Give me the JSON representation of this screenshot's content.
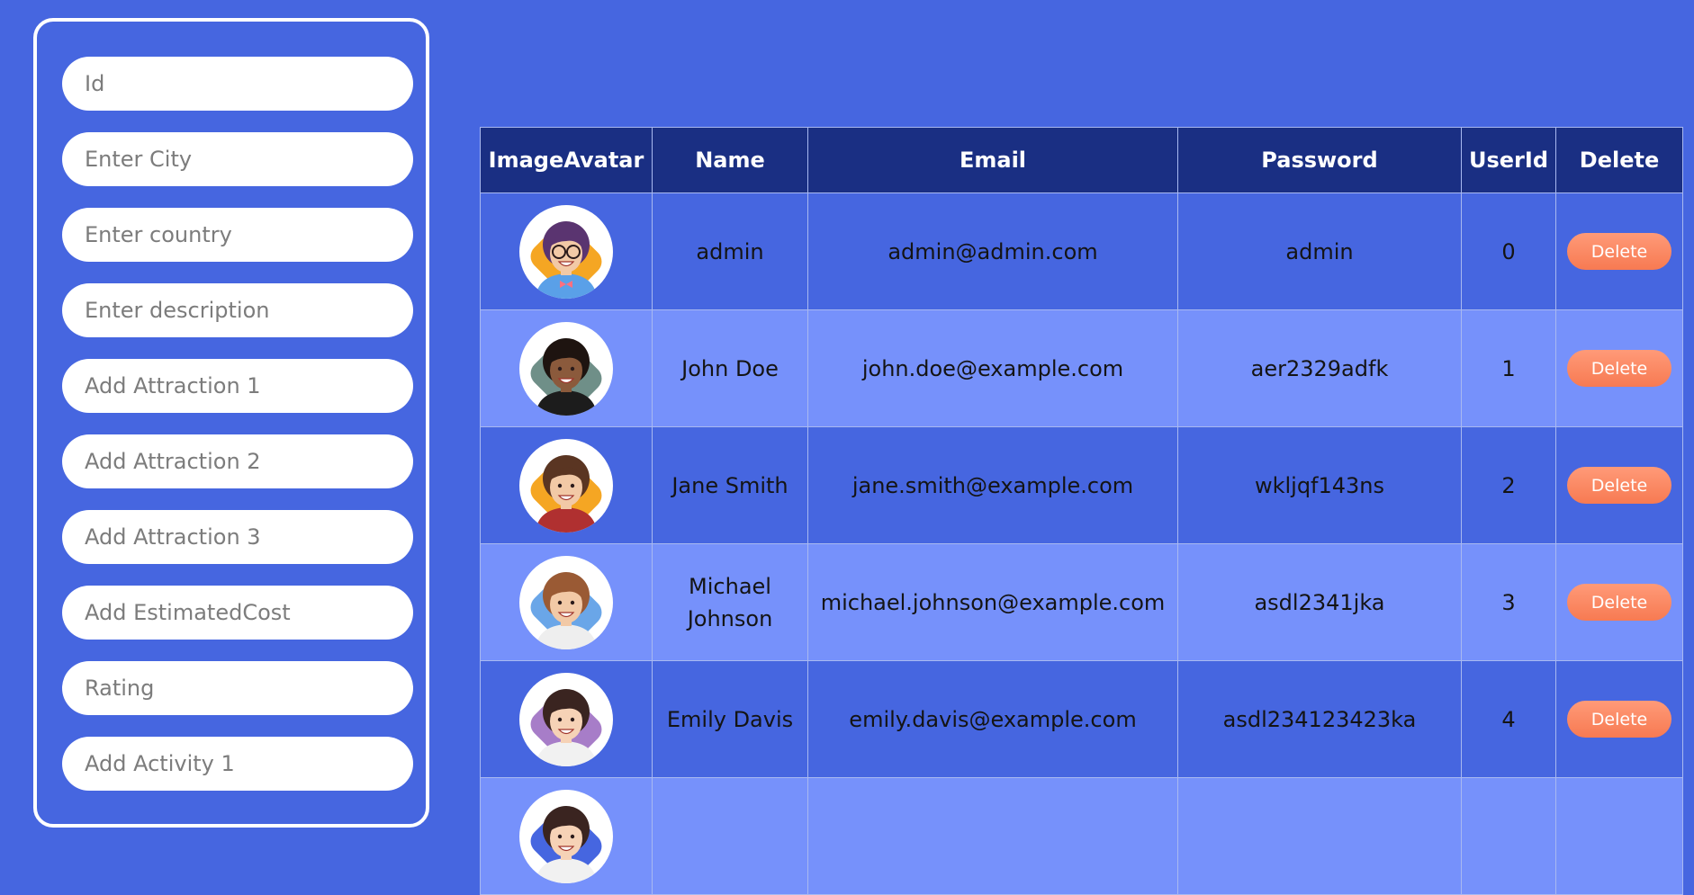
{
  "form": {
    "fields": [
      {
        "name": "id-input",
        "placeholder": "Id"
      },
      {
        "name": "city-input",
        "placeholder": "Enter City"
      },
      {
        "name": "country-input",
        "placeholder": "Enter country"
      },
      {
        "name": "description-input",
        "placeholder": "Enter description"
      },
      {
        "name": "attraction-1-input",
        "placeholder": "Add Attraction 1"
      },
      {
        "name": "attraction-2-input",
        "placeholder": "Add Attraction 2"
      },
      {
        "name": "attraction-3-input",
        "placeholder": "Add Attraction 3"
      },
      {
        "name": "estimated-cost-input",
        "placeholder": "Add EstimatedCost"
      },
      {
        "name": "rating-input",
        "placeholder": "Rating"
      },
      {
        "name": "activity-1-input",
        "placeholder": "Add Activity 1"
      }
    ]
  },
  "table": {
    "headers": {
      "avatar": "ImageAvatar",
      "name": "Name",
      "email": "Email",
      "password": "Password",
      "userid": "UserId",
      "delete": "Delete"
    },
    "rows": [
      {
        "name": "admin",
        "email": "admin@admin.com",
        "password": "admin",
        "userid": "0",
        "delete": "Delete",
        "avatar": {
          "bg": "#f5a623",
          "hair": "#5a3470",
          "skin": "#f2c9a6",
          "shirt": "#5aa0e8",
          "glasses": true,
          "bow": true
        }
      },
      {
        "name": "John Doe",
        "email": "john.doe@example.com",
        "password": "aer2329adfk",
        "userid": "1",
        "delete": "Delete",
        "avatar": {
          "bg": "#6f8f88",
          "hair": "#1e1410",
          "skin": "#8b5a3c",
          "shirt": "#1c1c1c",
          "glasses": false,
          "bow": false
        }
      },
      {
        "name": "Jane Smith",
        "email": "jane.smith@example.com",
        "password": "wkljqf143ns",
        "userid": "2",
        "delete": "Delete",
        "avatar": {
          "bg": "#f5a623",
          "hair": "#5a3522",
          "skin": "#f2c9a6",
          "shirt": "#b03030",
          "glasses": false,
          "bow": false
        }
      },
      {
        "name": "Michael Johnson",
        "email": "michael.johnson@example.com",
        "password": "asdl2341jka",
        "userid": "3",
        "delete": "Delete",
        "avatar": {
          "bg": "#6aa6e8",
          "hair": "#9a5a34",
          "skin": "#f2c9a6",
          "shirt": "#eeeeee",
          "glasses": false,
          "bow": false
        }
      },
      {
        "name": "Emily Davis",
        "email": "emily.davis@example.com",
        "password": "asdl234123423ka",
        "userid": "4",
        "delete": "Delete",
        "avatar": {
          "bg": "#a77dc8",
          "hair": "#3a2420",
          "skin": "#f6d2b6",
          "shirt": "#f1f1f1",
          "glasses": false,
          "bow": false
        }
      },
      {
        "name": "",
        "email": "",
        "password": "",
        "userid": "",
        "delete": "",
        "avatar": {
          "bg": "#4666e0",
          "hair": "#3a2420",
          "skin": "#f6d2b6",
          "shirt": "#f1f1f1",
          "glasses": false,
          "bow": false
        }
      }
    ]
  },
  "colors": {
    "page_bg": "#4666e0",
    "header_bg": "#1a2f83",
    "row_odd": "#4666e0",
    "row_even": "#7691fb",
    "delete_button": "#f88a64"
  }
}
